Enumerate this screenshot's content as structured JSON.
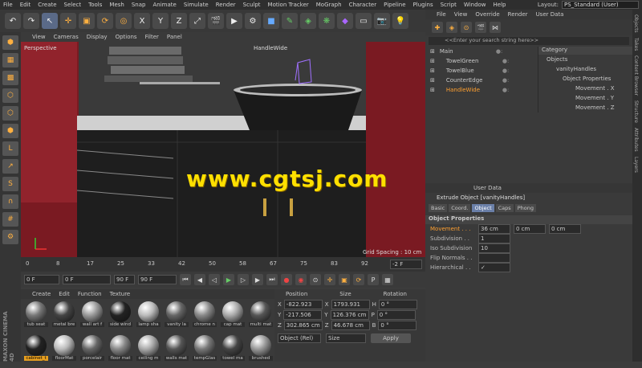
{
  "menu": [
    "File",
    "Edit",
    "Create",
    "Select",
    "Tools",
    "Mesh",
    "Snap",
    "Animate",
    "Simulate",
    "Render",
    "Sculpt",
    "Motion Tracker",
    "MoGraph",
    "Character",
    "Pipeline",
    "Plugins",
    "Script",
    "Window",
    "Help"
  ],
  "layout": {
    "label": "Layout:",
    "value": "PS_Standard (User)"
  },
  "viewport": {
    "menu": [
      "View",
      "Cameras",
      "Display",
      "Options",
      "Filter",
      "Panel"
    ],
    "name": "Perspective",
    "object_label": "HandleWide",
    "grid_spacing": "Grid Spacing : 10 cm"
  },
  "timeline": {
    "ticks": [
      "0",
      "8",
      "17",
      "25",
      "33",
      "42",
      "50",
      "58",
      "67",
      "75",
      "83",
      "92"
    ],
    "end": "-2 F"
  },
  "playback": {
    "start": "0 F",
    "cur": "0 F",
    "end": "90 F",
    "end2": "90 F"
  },
  "materials": {
    "menu": [
      "Create",
      "Edit",
      "Function",
      "Texture"
    ],
    "row1": [
      "tub seat",
      "metal bre",
      "wall art f",
      "side wind",
      "lamp sha",
      "vanity la",
      "chrome n",
      "cap mat",
      "multi mat"
    ],
    "row2": [
      "cabinet_t",
      "floorMat",
      "porcelair",
      "floor mat",
      "ceiling m",
      "walls mat",
      "tempGlas",
      "towel ma",
      "brushed"
    ]
  },
  "coordinates": {
    "headers": [
      "Position",
      "Size",
      "Rotation"
    ],
    "rows": [
      {
        "axis": "X",
        "pos": "-822.923 cm",
        "sub": "X",
        "size": "1793.931 cm",
        "rlabel": "H",
        "rot": "0 °"
      },
      {
        "axis": "Y",
        "pos": "-217.506 cm",
        "sub": "Y",
        "size": "126.376 cm",
        "rlabel": "P",
        "rot": "0 °"
      },
      {
        "axis": "Z",
        "pos": "302.865 cm",
        "sub": "Z",
        "size": "46.678 cm",
        "rlabel": "B",
        "rot": "0 °"
      }
    ],
    "mode": "Object (Rel)",
    "size_mode": "Size",
    "apply": "Apply"
  },
  "objects": {
    "menu": [
      "File",
      "View",
      "Override",
      "Render",
      "User Data"
    ],
    "search": "<<Enter your search string here>>",
    "items": [
      "Main",
      "TowelGreen",
      "TowelBlue",
      "CounterEdge",
      "HandleWide"
    ],
    "category_header": "Category",
    "tree": [
      "Objects",
      "vanityHandles",
      "Object Properties",
      "Movement . X",
      "Movement . Y",
      "Movement . Z"
    ]
  },
  "attributes": {
    "menu": [
      "User Data"
    ],
    "title": "Extrude Object [vanityHandles]",
    "tabs": [
      "Basic",
      "Coord.",
      "Object",
      "Caps",
      "Phong"
    ],
    "section": "Object Properties",
    "props": [
      {
        "label": "Movement . . .",
        "v1": "36 cm",
        "v2": "0 cm",
        "v3": "0 cm"
      },
      {
        "label": "Subdivision . .",
        "v1": "1"
      },
      {
        "label": "Iso Subdivision",
        "v1": "10"
      },
      {
        "label": "Flip Normals . .",
        "v1": ""
      },
      {
        "label": "Hierarchical . .",
        "v1": "✓"
      }
    ]
  },
  "side_tabs": [
    "Objects",
    "Takes",
    "Content Browser",
    "Structure",
    "Attributes",
    "Layers"
  ],
  "watermark": "www.cgtsj.com",
  "brand": "MAXON CINEMA 4D"
}
